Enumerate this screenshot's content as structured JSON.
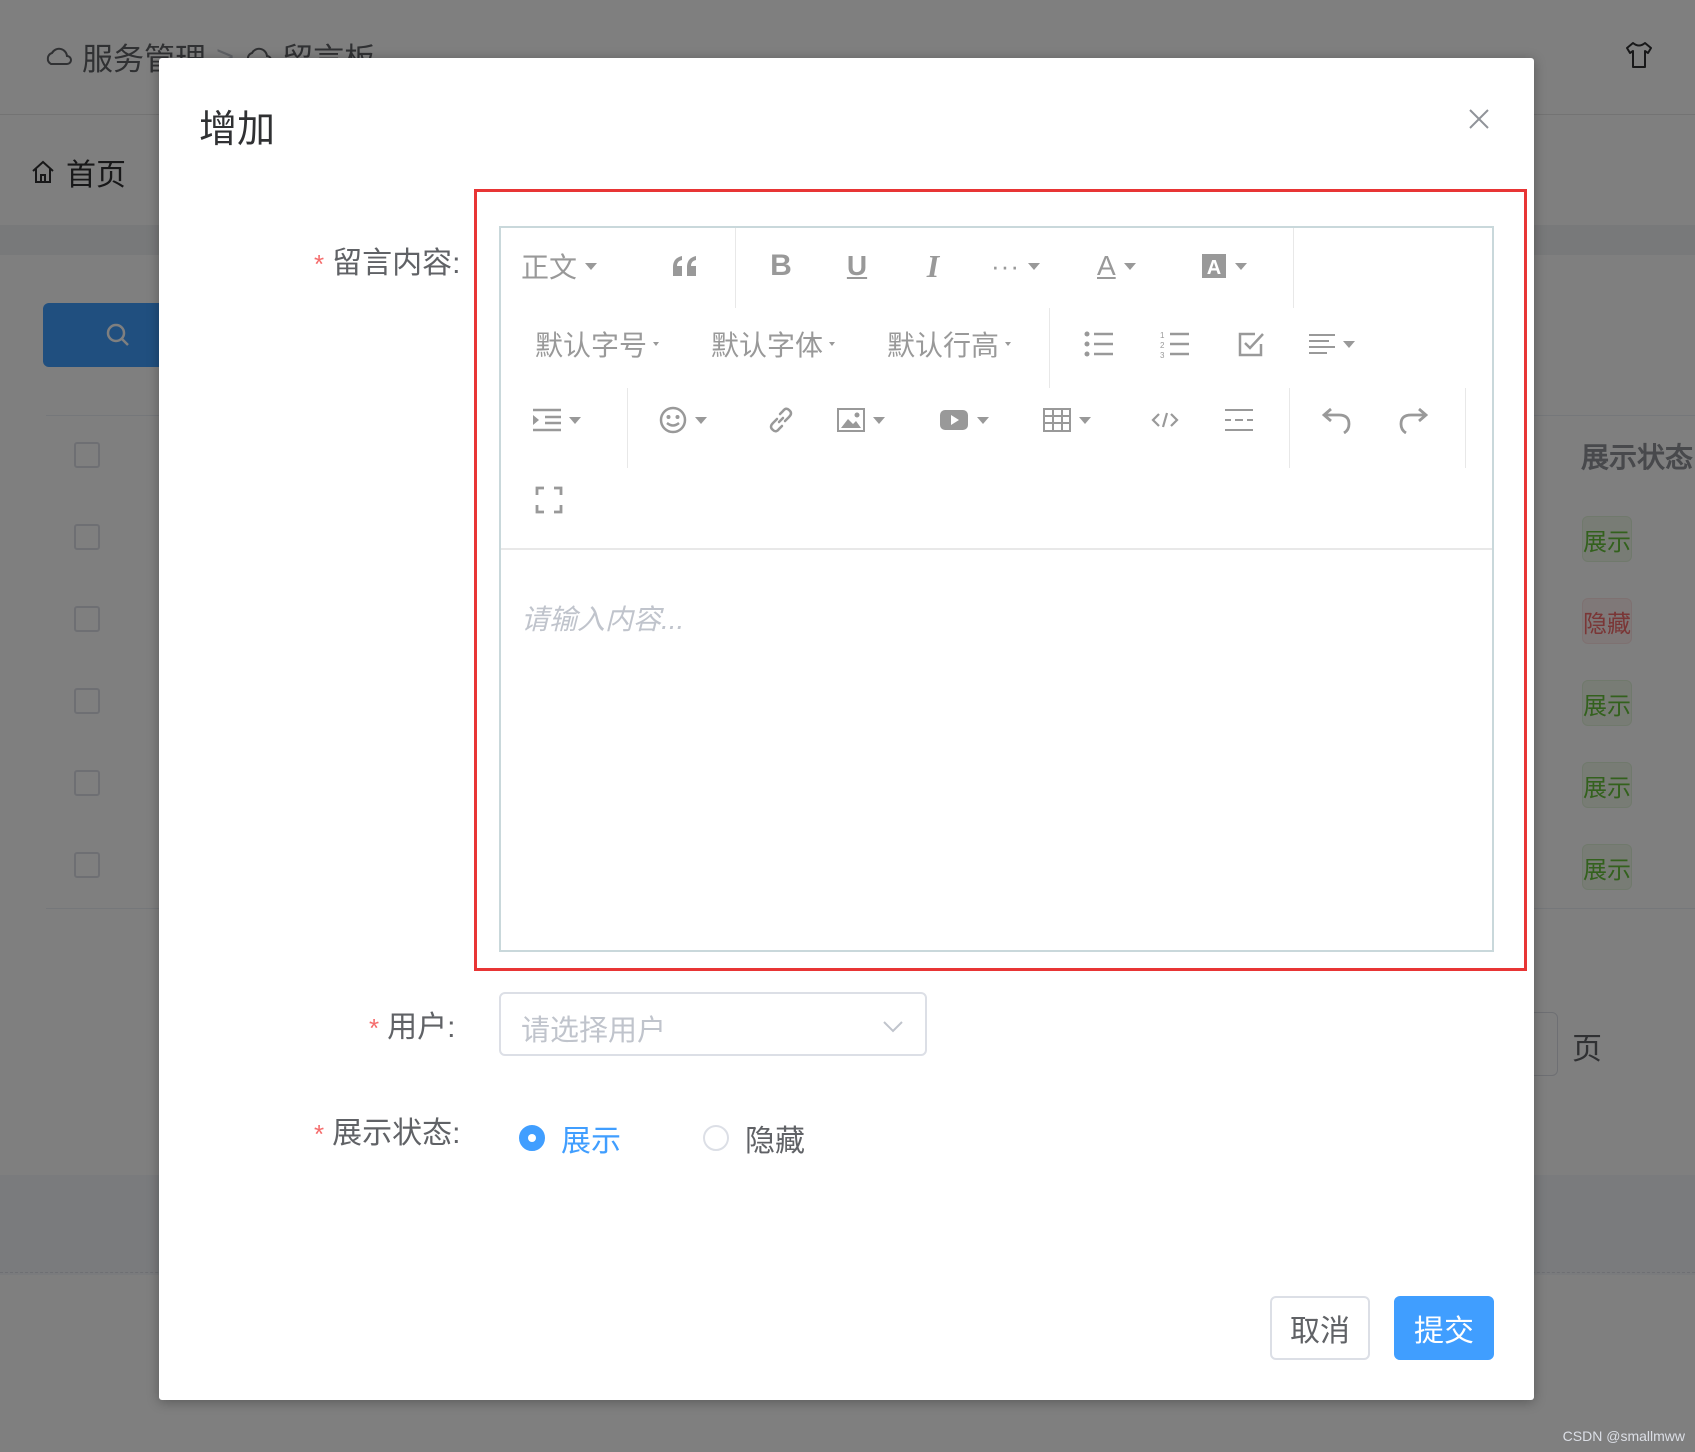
{
  "background": {
    "breadcrumb": [
      "服务管理",
      ">",
      "留言板"
    ],
    "home_tab": "首页",
    "column_header": "展示状态",
    "rows": [
      {
        "status": "展示",
        "type": "show"
      },
      {
        "status": "隐藏",
        "type": "hide"
      },
      {
        "status": "展示",
        "type": "show"
      },
      {
        "status": "展示",
        "type": "show"
      },
      {
        "status": "展示",
        "type": "show"
      }
    ],
    "pagination_suffix": "页",
    "watermark": "CSDN @smallmww"
  },
  "dialog": {
    "title": "增加",
    "fields": {
      "content_label": "留言内容:",
      "user_label": "用户:",
      "status_label": "展示状态:"
    },
    "editor": {
      "heading": "正文",
      "font_size": "默认字号",
      "font_family": "默认字体",
      "line_height": "默认行高",
      "placeholder": "请输入内容..."
    },
    "user_select": {
      "placeholder": "请选择用户"
    },
    "status_options": [
      {
        "label": "展示",
        "selected": true
      },
      {
        "label": "隐藏",
        "selected": false
      }
    ],
    "buttons": {
      "cancel": "取消",
      "submit": "提交"
    }
  },
  "colors": {
    "primary": "#409eff",
    "danger": "#f56c6c",
    "highlight_border": "#e83535"
  }
}
